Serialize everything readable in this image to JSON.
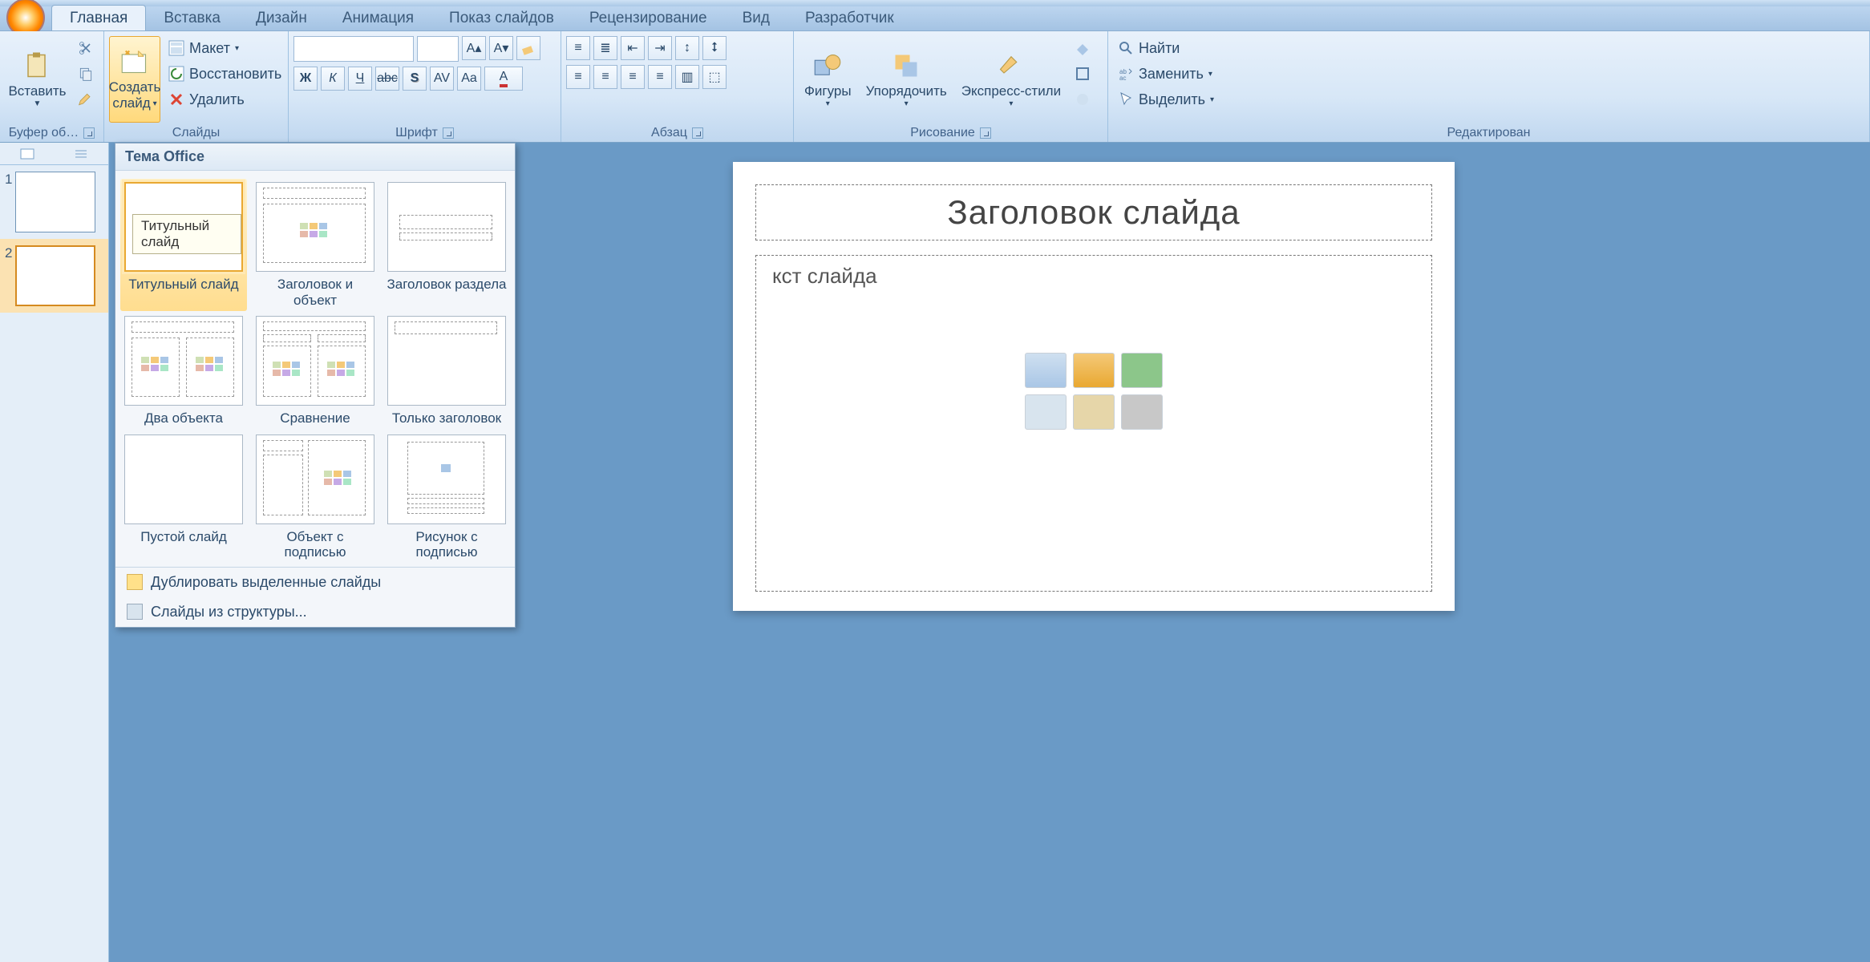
{
  "tabs": [
    "Главная",
    "Вставка",
    "Дизайн",
    "Анимация",
    "Показ слайдов",
    "Рецензирование",
    "Вид",
    "Разработчик"
  ],
  "active_tab": 0,
  "groups": {
    "clipboard": {
      "label": "Буфер об…",
      "paste": "Вставить"
    },
    "slides": {
      "label": "Слайды",
      "new_slide": "Создать",
      "new_slide2": "слайд",
      "layout": "Макет",
      "reset": "Восстановить",
      "delete": "Удалить"
    },
    "font": {
      "label": "Шрифт"
    },
    "paragraph": {
      "label": "Абзац"
    },
    "drawing": {
      "label": "Рисование",
      "shapes": "Фигуры",
      "arrange": "Упорядочить",
      "quick_styles": "Экспресс-стили"
    },
    "editing": {
      "label": "Редактирован",
      "find": "Найти",
      "replace": "Заменить",
      "select": "Выделить"
    }
  },
  "gallery": {
    "header": "Тема Office",
    "tooltip": "Титульный слайд",
    "items": [
      "Титульный слайд",
      "Заголовок и объект",
      "Заголовок раздела",
      "Два объекта",
      "Сравнение",
      "Только заголовок",
      "Пустой слайд",
      "Объект с подписью",
      "Рисунок с подписью"
    ],
    "selected": 0,
    "actions": [
      "Дублировать выделенные слайды",
      "Слайды из структуры..."
    ]
  },
  "slidepanel": {
    "thumbs": [
      {
        "n": "1"
      },
      {
        "n": "2"
      }
    ],
    "selected": 1
  },
  "slide": {
    "title": "Заголовок слайда",
    "body": "кст слайда"
  }
}
